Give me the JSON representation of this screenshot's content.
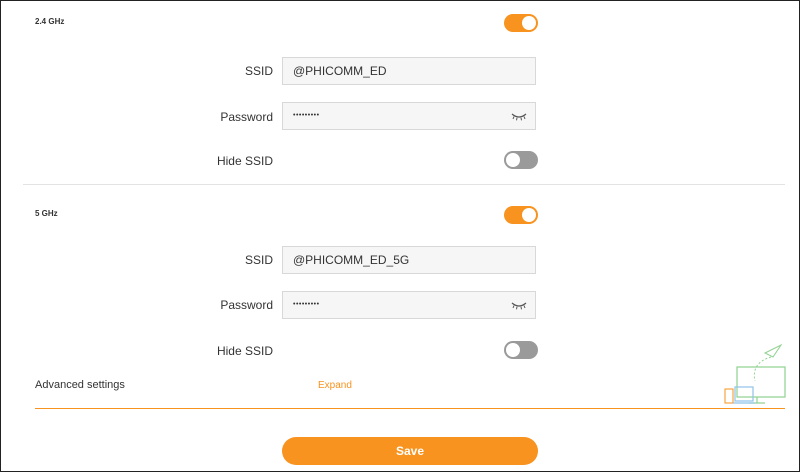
{
  "band_24": {
    "title": "2.4 GHz",
    "enabled": true,
    "ssid_label": "SSID",
    "ssid_value": "@PHICOMM_ED",
    "password_label": "Password",
    "password_value": "•••••••••",
    "hide_ssid_label": "Hide SSID",
    "hide_ssid": false
  },
  "band_5": {
    "title": "5 GHz",
    "enabled": true,
    "ssid_label": "SSID",
    "ssid_value": "@PHICOMM_ED_5G",
    "password_label": "Password",
    "password_value": "•••••••••",
    "hide_ssid_label": "Hide SSID",
    "hide_ssid": false
  },
  "advanced": {
    "label": "Advanced settings",
    "expand_label": "Expand"
  },
  "save_label": "Save",
  "icons": {
    "password_reveal": "eye-closed-icon",
    "illustration": "devices-illustration-icon"
  },
  "colors": {
    "accent": "#f7931e",
    "toggle_off": "#9a9a9a",
    "input_bg": "#f6f6f6",
    "illustration_green": "#8fd18f",
    "illustration_blue": "#8fc3e8"
  }
}
